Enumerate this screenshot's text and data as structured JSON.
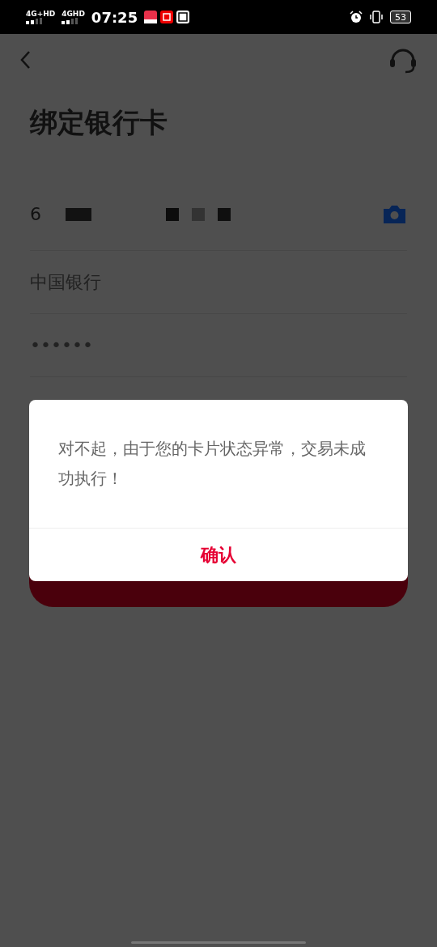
{
  "status_bar": {
    "network_1": "4G+HD",
    "network_2": "4GHD",
    "time": "07:25",
    "battery": "53"
  },
  "title": "绑定银行卡",
  "fields": [
    {
      "kind": "card",
      "value": "6"
    },
    {
      "kind": "text",
      "value": "中国银行"
    },
    {
      "kind": "text",
      "value": "••••••"
    }
  ],
  "dialog": {
    "message": "对不起，由于您的卡片状态异常，交易未成功执行！",
    "confirm": "确认"
  }
}
